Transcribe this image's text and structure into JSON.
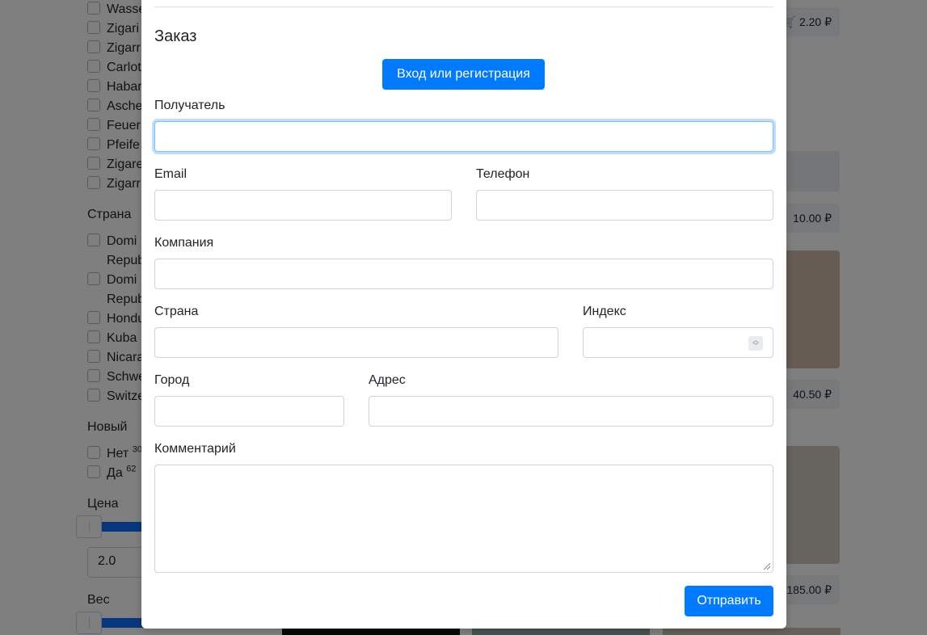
{
  "background": {
    "sidebar_items_top": [
      "Wasse",
      "Zigari",
      "Zigarr",
      "Carlot",
      "Haban",
      "Asche",
      "Feuer",
      "Pfeife",
      "Zigare",
      "Zigarr"
    ],
    "country_heading": "Страна",
    "country_items": [
      "Domi",
      "Repub",
      "Domi",
      "Repub",
      "Hondu",
      "Kuba",
      "Nicara",
      "Schwe",
      "Switze"
    ],
    "new_heading": "Новый",
    "new_items": [
      {
        "label": "Нет",
        "count": "30"
      },
      {
        "label": "Да",
        "count": "62"
      }
    ],
    "price_heading": "Цена",
    "price_min_value": "2.0",
    "weight_heading": "Вес",
    "prices": [
      "2.20 ₽",
      "10.00 ₽",
      "40.50 ₽",
      "185.00 ₽"
    ]
  },
  "modal": {
    "title": "Заказ",
    "login_button": "Вход или регистрация",
    "recipient_label": "Получатель",
    "recipient_value": "",
    "email_label": "Email",
    "phone_label": "Телефон",
    "company_label": "Компания",
    "country_label": "Страна",
    "zip_label": "Индекс",
    "city_label": "Город",
    "address_label": "Адрес",
    "comment_label": "Комментарий",
    "submit_button": "Отправить"
  },
  "colors": {
    "primary": "#007bff",
    "backdrop": "rgba(0,0,0,0.5)"
  }
}
